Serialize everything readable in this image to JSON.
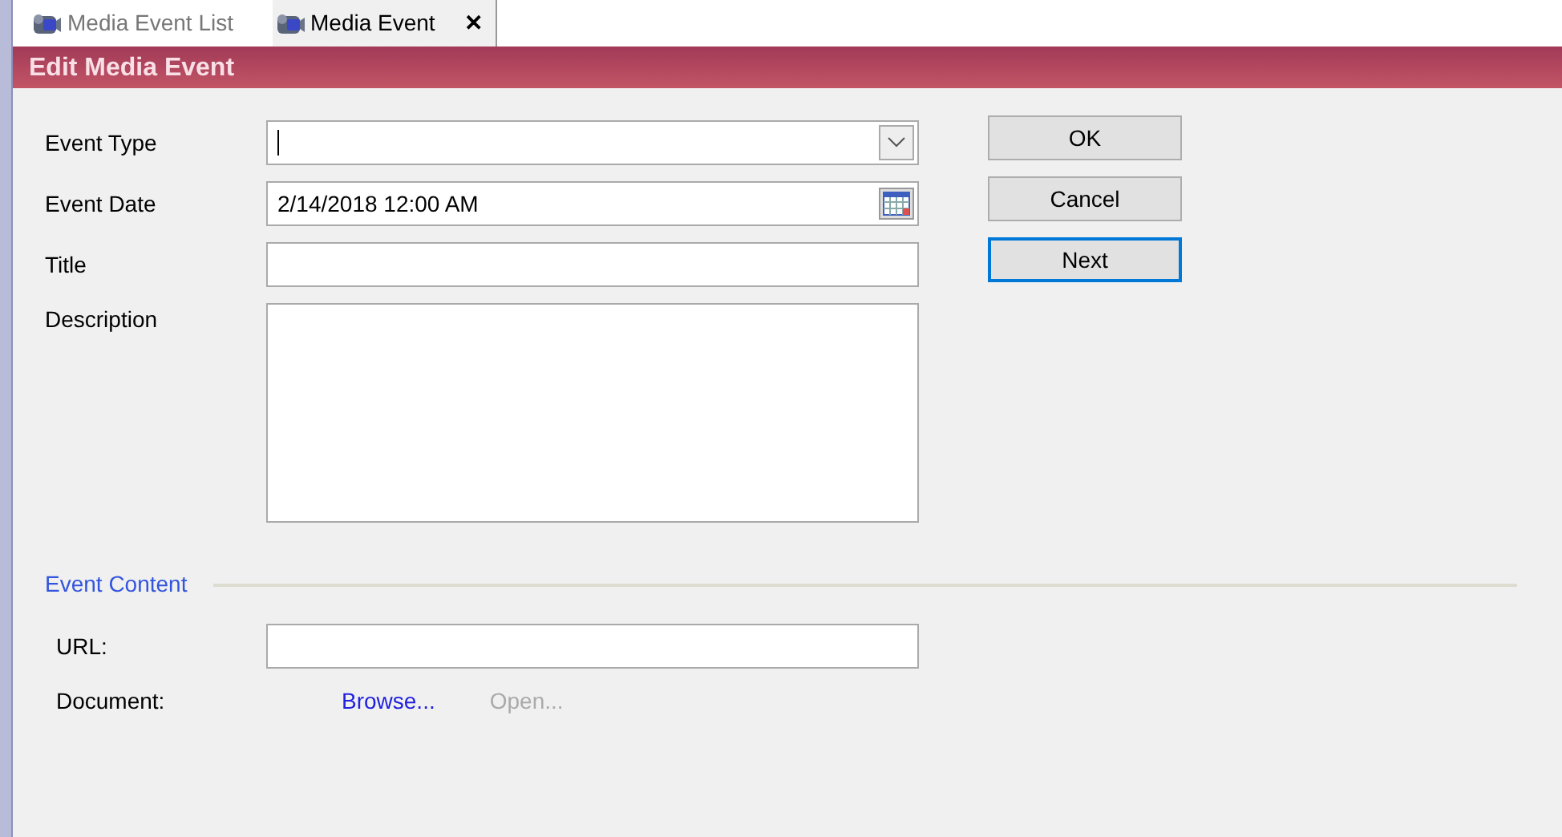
{
  "tabs": [
    {
      "label": "Media Event List",
      "selected": false
    },
    {
      "label": "Media Event",
      "selected": true,
      "close": "✕"
    }
  ],
  "header": {
    "title": "Edit Media Event"
  },
  "fields": [
    {
      "kind": "combo",
      "label": "Event Type",
      "focused": true
    },
    {
      "kind": "date",
      "label": "Event Date",
      "value": "2/14/2018 12:00 AM",
      "focused": false
    },
    {
      "kind": "text",
      "label": "Title",
      "focused": false
    },
    {
      "kind": "textarea",
      "label": "Description",
      "focused": false
    }
  ],
  "buttons": [
    {
      "label": "OK",
      "focused": false
    },
    {
      "label": "Cancel",
      "focused": false
    },
    {
      "label": "Next",
      "focused": true
    }
  ],
  "content_section": {
    "title": "Event Content",
    "url": {
      "label": "URL:"
    },
    "document": {
      "label": "Document:",
      "links": [
        {
          "label": "Browse...",
          "disabled": false
        },
        {
          "label": "Open...",
          "disabled": true
        }
      ]
    }
  }
}
